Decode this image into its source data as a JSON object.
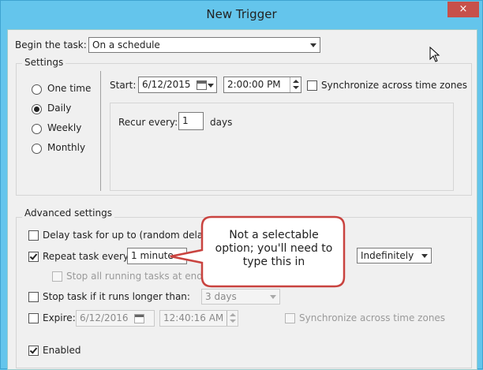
{
  "window": {
    "title": "New Trigger",
    "close_icon": "×"
  },
  "begin": {
    "label": "Begin the task:",
    "value": "On a schedule"
  },
  "settings": {
    "group_title": "Settings",
    "frequency_options": [
      "One time",
      "Daily",
      "Weekly",
      "Monthly"
    ],
    "selected_frequency": "Daily",
    "start_label": "Start:",
    "start_date": "6/12/2015",
    "start_time": "2:00:00 PM",
    "sync_label": "Synchronize across time zones",
    "recur_label": "Recur every:",
    "recur_value": "1",
    "recur_unit": "days"
  },
  "advanced": {
    "group_title": "Advanced settings",
    "delay_label": "Delay task for up to (random delay):",
    "repeat_label": "Repeat task every:",
    "repeat_value": "1 minute",
    "repeat_duration_value": "Indefinitely",
    "stop_running_label": "Stop all running tasks at end of re",
    "stop_longer_label": "Stop task if it runs longer than:",
    "stop_longer_value": "3 days",
    "expire_label": "Expire:",
    "expire_date": "6/12/2016",
    "expire_time": "12:40:16 AM",
    "expire_sync_label": "Synchronize across time zones",
    "enabled_label": "Enabled"
  },
  "callout": {
    "text_line1": "Not a selectable",
    "text_line2": "option; you'll need to",
    "text_line3": "type this in",
    "border_color": "#c9433f"
  }
}
